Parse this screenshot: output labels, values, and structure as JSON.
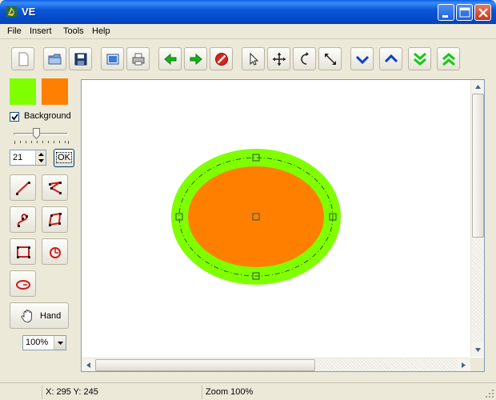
{
  "window": {
    "title": "VE"
  },
  "menu": {
    "items": [
      "File",
      "Insert",
      "Tools",
      "Help"
    ]
  },
  "toolbar": {
    "buttons": [
      {
        "name": "new-file",
        "icon": "blank-page-icon"
      },
      {
        "name": "open-file",
        "icon": "folder-icon"
      },
      {
        "name": "save-file",
        "icon": "floppy-disk-icon"
      },
      {
        "name": "image",
        "icon": "picture-icon"
      },
      {
        "name": "print",
        "icon": "printer-icon"
      },
      {
        "name": "back",
        "icon": "arrow-left-icon"
      },
      {
        "name": "forward",
        "icon": "arrow-right-icon"
      },
      {
        "name": "stop",
        "icon": "stop-icon"
      },
      {
        "name": "select",
        "icon": "pointer-arrow-icon"
      },
      {
        "name": "move",
        "icon": "move-cross-icon"
      },
      {
        "name": "rotate",
        "icon": "rotate-icon"
      },
      {
        "name": "resize",
        "icon": "resize-diagonal-icon"
      },
      {
        "name": "move-down",
        "icon": "chevron-down-icon"
      },
      {
        "name": "move-up",
        "icon": "chevron-up-icon"
      },
      {
        "name": "to-bottom",
        "icon": "double-chevron-down-icon"
      },
      {
        "name": "to-top",
        "icon": "double-chevron-up-icon"
      }
    ]
  },
  "colors": {
    "stroke_color": "#80ff00",
    "fill_color": "#ff8000",
    "accent_blue": "#0a5fe6",
    "arrow_green": "#16b31a"
  },
  "panel": {
    "background_label": "Background",
    "background_checked": true,
    "slider_level_fraction": 0.4,
    "line_width_value": "21",
    "ok_label": "OK",
    "hand_label": "Hand",
    "zoom_value": "100%",
    "tools": [
      "line-tool-icon",
      "polyline-tool-icon",
      "curve-tool-icon",
      "polygon-tool-icon",
      "rectangle-tool-icon",
      "arc-tool-icon",
      "ellipse-tool-icon"
    ]
  },
  "statusbar": {
    "coordinates": "X: 295 Y: 245",
    "zoom": "Zoom 100%"
  }
}
